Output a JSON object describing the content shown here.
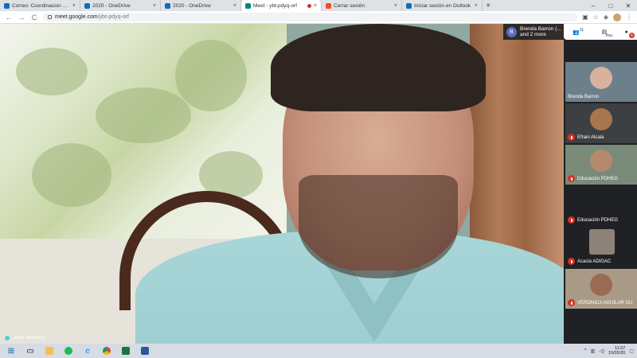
{
  "browser": {
    "tabs": [
      {
        "label": "Correo: Coordinacion de Educació",
        "fav_color": "#0f6cbd",
        "active": false
      },
      {
        "label": "2020 - OneDrive",
        "fav_color": "#0f6cbd",
        "active": false
      },
      {
        "label": "2020 - OneDrive",
        "fav_color": "#0f6cbd",
        "active": false
      },
      {
        "label": "Meet - ybt-pdyq-orf",
        "fav_color": "#00897b",
        "active": true
      },
      {
        "label": "Cerrar sesión",
        "fav_color": "#f25022",
        "active": false
      },
      {
        "label": "Iniciar sesión en Outlook",
        "fav_color": "#0f6cbd",
        "active": false
      }
    ],
    "close_glyph": "×",
    "new_tab_glyph": "+",
    "window_controls": [
      "–",
      "□",
      "✕"
    ],
    "url_host": "meet.google.com",
    "url_path": "/ybt-pdyq-orf",
    "nav": {
      "back": "←",
      "forward": "→",
      "reload": "C"
    }
  },
  "meet": {
    "speaker_name": "Jose Montero",
    "join_avatar_letter": "B",
    "join_line1": "Brenda Barron (...",
    "join_line2": "and 2 more",
    "people_count": "11",
    "you_label": "You",
    "notif_count": "6",
    "participants": [
      {
        "name": "Brenda Barron",
        "muted": false,
        "bg": "#6e7f8c",
        "face": "#d7b29c"
      },
      {
        "name": "Efrain Alcala",
        "muted": true,
        "bg": "#3c4043",
        "face": "#a8764e"
      },
      {
        "name": "Educación PDHEG",
        "muted": true,
        "bg": "#7a8a78",
        "face": "#b48a6e"
      },
      {
        "name": "Educación PDHEG",
        "muted": true,
        "bg": "#202124",
        "face": ""
      },
      {
        "name": "Acacia ADIGAC",
        "muted": true,
        "bg": "#8c8278",
        "face": "#c9b3a3"
      },
      {
        "name": "VERONICA AGUILAR GU",
        "muted": true,
        "bg": "#a89a86",
        "face": "#9a6b52"
      }
    ]
  },
  "taskbar": {
    "apps": [
      "start",
      "search",
      "file-explorer",
      "spotify",
      "edge",
      "chrome",
      "excel",
      "word"
    ],
    "time": "11:57",
    "date": "15/05/20"
  }
}
